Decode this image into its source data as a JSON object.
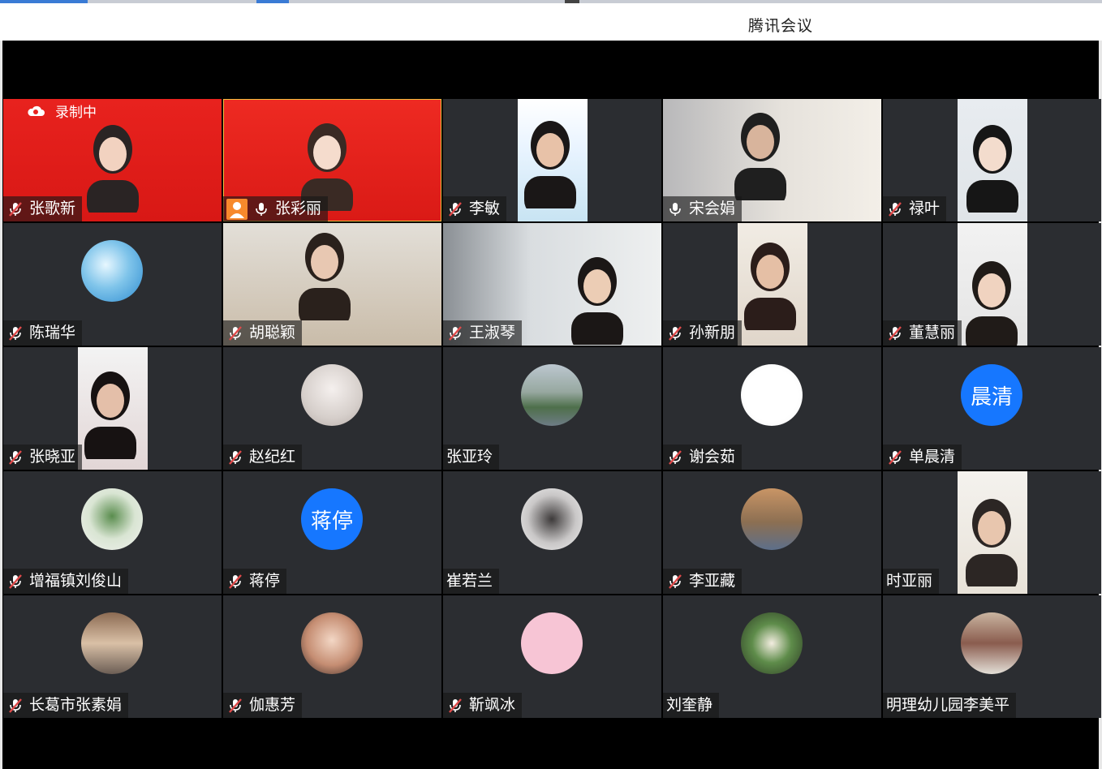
{
  "app": {
    "title": "腾讯会议",
    "recording_label": "录制中"
  },
  "colors": {
    "tile_bg": "#2b2d31",
    "stage_bg": "#000000",
    "mute_red": "#e04a4a",
    "host_orange": "#f7892c",
    "avatar_blue": "#1677ff"
  },
  "participants": [
    {
      "name": "张歌新",
      "mic": "muted"
    },
    {
      "name": "张彩丽",
      "mic": "on",
      "host": true
    },
    {
      "name": "李敏",
      "mic": "muted"
    },
    {
      "name": "宋会娟",
      "mic": "on"
    },
    {
      "name": "禄叶",
      "mic": "muted"
    },
    {
      "name": "陈瑞华",
      "mic": "muted"
    },
    {
      "name": "胡聪颖",
      "mic": "muted"
    },
    {
      "name": "王淑琴",
      "mic": "muted"
    },
    {
      "name": "孙新朋",
      "mic": "muted"
    },
    {
      "name": "董慧丽",
      "mic": "muted"
    },
    {
      "name": "张晓亚",
      "mic": "muted"
    },
    {
      "name": "赵纪红",
      "mic": "muted"
    },
    {
      "name": "张亚玲",
      "mic": "none"
    },
    {
      "name": "谢会茹",
      "mic": "muted"
    },
    {
      "name": "单晨清",
      "mic": "muted",
      "avatar_text": "晨清"
    },
    {
      "name": "增福镇刘俊山",
      "mic": "muted"
    },
    {
      "name": "蒋停",
      "mic": "muted",
      "avatar_text": "蒋停"
    },
    {
      "name": "崔若兰",
      "mic": "none"
    },
    {
      "name": "李亚藏",
      "mic": "muted"
    },
    {
      "name": "时亚丽",
      "mic": "none"
    },
    {
      "name": "长葛市张素娟",
      "mic": "muted"
    },
    {
      "name": "伽惠芳",
      "mic": "muted"
    },
    {
      "name": "靳飒冰",
      "mic": "muted"
    },
    {
      "name": "刘奎静",
      "mic": "none"
    },
    {
      "name": "明理幼儿园李美平",
      "mic": "none"
    }
  ]
}
